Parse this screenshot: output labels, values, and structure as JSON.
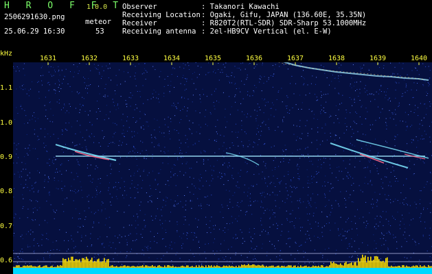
{
  "header": {
    "brand": "H R O F F T",
    "version": "1.0.0",
    "filename": "2506291630.png",
    "timestamp": "25.06.29 16:30",
    "meteor_label": "meteor",
    "meteor_count": "53",
    "info": [
      {
        "key": "Observer",
        "value": ": Takanori Kawachi"
      },
      {
        "key": "Receiving Location",
        "value": ": Ogaki, Gifu, JAPAN (136.60E, 35.35N)"
      },
      {
        "key": "Receiver",
        "value": ": R820T2(RTL-SDR) SDR-Sharp 53.1000MHz"
      },
      {
        "key": "Receiving antenna",
        "value": ": 2el-HB9CV Vertical (el. E-W)"
      }
    ]
  },
  "axis": {
    "unit": "kHz",
    "x_ticks": [
      "1631",
      "1632",
      "1633",
      "1634",
      "1635",
      "1636",
      "1637",
      "1638",
      "1639",
      "1640"
    ],
    "y_ticks": [
      "1.1",
      "1.0",
      "0.9",
      "0.8",
      "0.7",
      "0.6"
    ]
  },
  "colors": {
    "background": "#000000",
    "noise": "#0a1a6e",
    "tick_text": "#ffff40",
    "brand": "#7cff6a",
    "carrier": "#9fe7ff",
    "meteor": "#ff6a8a",
    "bars": "#ffe000",
    "baseline": "#00d8ff"
  }
}
